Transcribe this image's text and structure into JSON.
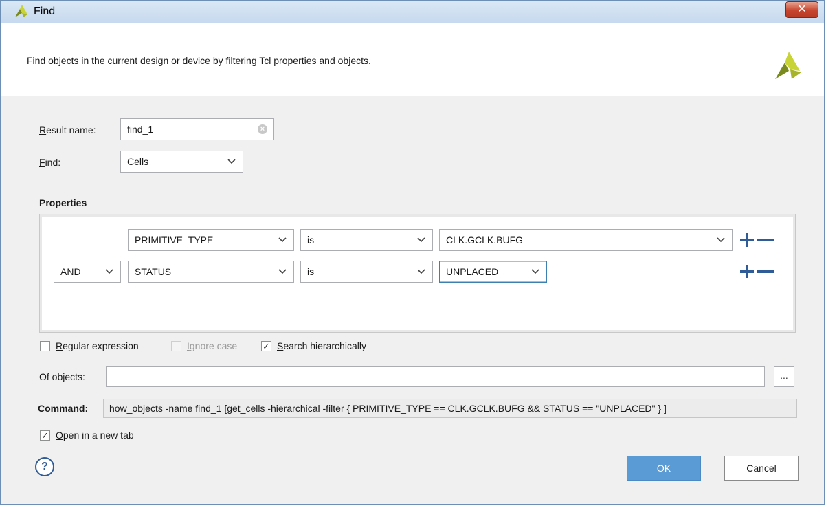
{
  "window": {
    "title": "Find",
    "close_symbol": "✕",
    "icon": "vivado-logo-icon"
  },
  "header": {
    "description": "Find objects in the current design or device by filtering Tcl properties and objects."
  },
  "form": {
    "result_name_label": "Result name:",
    "result_name_value": "find_1",
    "find_label": "Find:",
    "find_value": "Cells"
  },
  "properties": {
    "title": "Properties",
    "rows": [
      {
        "logic": "",
        "property": "PRIMITIVE_TYPE",
        "operator": "is",
        "value": "CLK.GCLK.BUFG"
      },
      {
        "logic": "AND",
        "property": "STATUS",
        "operator": "is",
        "value": "UNPLACED"
      }
    ]
  },
  "options": {
    "regex_label": "Regular expression",
    "regex_checked": false,
    "ignore_case_label": "Ignore case",
    "ignore_case_checked": false,
    "search_hier_label": "Search hierarchically",
    "search_hier_checked": true
  },
  "of_objects": {
    "label": "Of objects:",
    "value": "",
    "browse_label": "..."
  },
  "command": {
    "label": "Command:",
    "text": "how_objects -name find_1 [get_cells -hierarchical -filter { PRIMITIVE_TYPE == CLK.GCLK.BUFG && STATUS == \"UNPLACED\" } ]"
  },
  "open_new_tab": {
    "label": "Open in a new tab",
    "checked": true
  },
  "buttons": {
    "help": "?",
    "ok": "OK",
    "cancel": "Cancel"
  },
  "check_glyph": "✓",
  "colors": {
    "accent": "#5b9bd5",
    "titlebar": "#c6d9ee",
    "plus_minus": "#2f5b96",
    "logo_green": "#7a8a1e",
    "logo_yellow": "#c8d435"
  }
}
